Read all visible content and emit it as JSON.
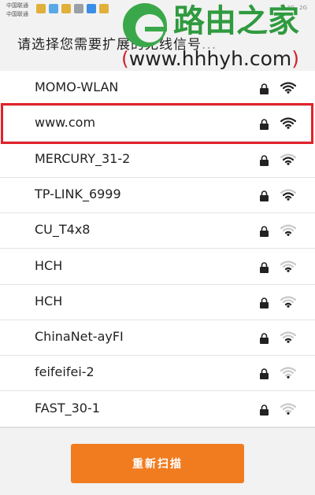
{
  "status_bar": {
    "carrier_1": "中国联通",
    "carrier_2": "中国联通",
    "network_4g": "4G",
    "network_2g": "2G"
  },
  "header": {
    "title": "请选择您需要扩展的无线信号",
    "title_tail": "..."
  },
  "watermark": {
    "brand": "路由之家",
    "url": "www.hhhyh.com",
    "paren_open": "(",
    "paren_close": ")",
    "brand_color": "#2f9a3e"
  },
  "networks": [
    {
      "ssid": "MOMO-WLAN",
      "locked": true,
      "signal_bars": 4
    },
    {
      "ssid": "www.com",
      "locked": true,
      "signal_bars": 4,
      "highlighted": true
    },
    {
      "ssid": "MERCURY_31-2",
      "locked": true,
      "signal_bars": 3
    },
    {
      "ssid": "TP-LINK_6999",
      "locked": true,
      "signal_bars": 3
    },
    {
      "ssid": "CU_T4x8",
      "locked": true,
      "signal_bars": 2
    },
    {
      "ssid": "HCH",
      "locked": true,
      "signal_bars": 2
    },
    {
      "ssid": "HCH",
      "locked": true,
      "signal_bars": 2
    },
    {
      "ssid": "ChinaNet-ayFI",
      "locked": true,
      "signal_bars": 2
    },
    {
      "ssid": "feifeifei-2",
      "locked": true,
      "signal_bars": 1
    },
    {
      "ssid": "FAST_30-1",
      "locked": true,
      "signal_bars": 1
    }
  ],
  "footer": {
    "rescan_label": "重新扫描",
    "rescan_color": "#f07c1f"
  },
  "colors": {
    "highlight_border": "#e2222a",
    "wifi_active": "#222222",
    "wifi_inactive": "#c8c8c8"
  }
}
